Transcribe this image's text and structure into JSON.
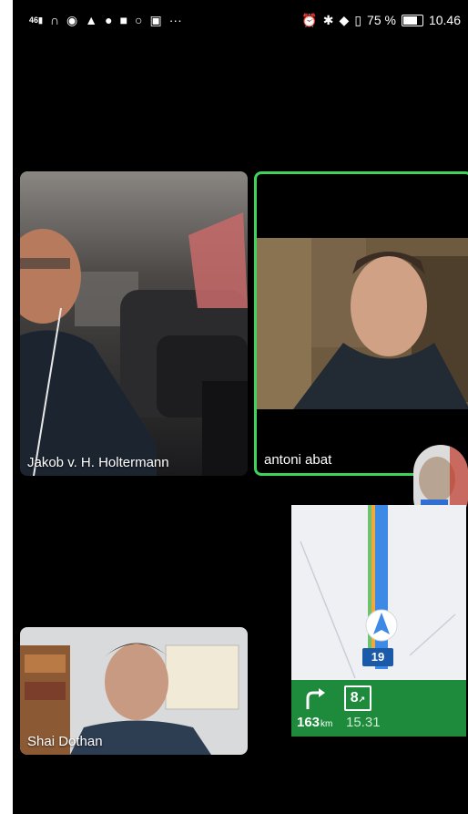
{
  "status_bar": {
    "left_icons": [
      "signal-icon",
      "headphones-icon",
      "eye-icon",
      "navigation-icon",
      "messenger-icon",
      "video-icon",
      "chat-icon",
      "calendar-icon",
      "more-icon"
    ],
    "right_icons": [
      "alarm-icon",
      "bluetooth-icon",
      "location-icon",
      "vibrate-icon"
    ],
    "battery": "75 %",
    "time": "10.46",
    "signal_text": "46",
    "more": "···"
  },
  "participants": [
    {
      "name": "Jakob v. H. Holtermann"
    },
    {
      "name": "antoni abat"
    },
    {
      "name": "Shai Dothan"
    }
  ],
  "navigation": {
    "route_number": "19",
    "turn_icon": "turn-right-icon",
    "exit": "8",
    "distance_value": "163",
    "distance_unit": "km",
    "eta": "15.31"
  },
  "colors": {
    "active_speaker_border": "#3ed35b",
    "nav_green": "#1e8a3c",
    "route_blue": "#1b5aa8"
  }
}
